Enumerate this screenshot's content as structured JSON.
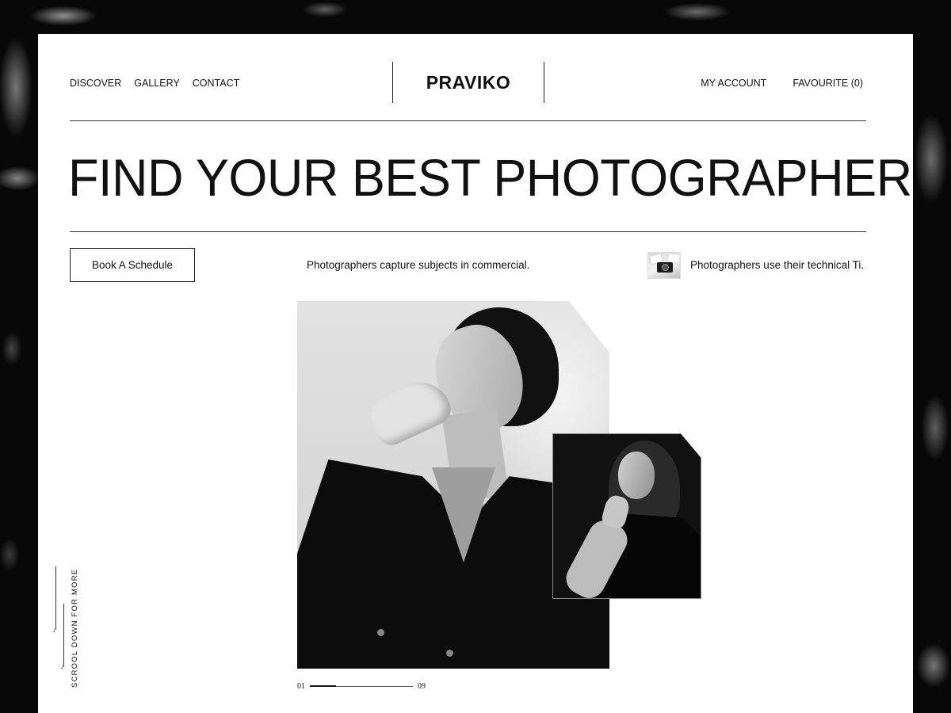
{
  "nav": {
    "left": [
      "DISCOVER",
      "GALLERY",
      "CONTACT"
    ],
    "brand": "PRAVIKO",
    "right": [
      "MY ACCOUNT",
      "FAVOURITE (0)"
    ]
  },
  "hero": {
    "title": "FIND YOUR BEST PHOTOGRAPHER",
    "cta_label": "Book A Schedule",
    "description_1": "Photographers capture subjects in commercial.",
    "description_2": "Photographers use their technical Ti."
  },
  "gallery": {
    "current_index": "01",
    "total": "09",
    "progress": 0.25
  },
  "scroll_hint": "SCROOL DOWN FOR MORE",
  "icons": {
    "thumbnail": "camera-thumbnail-icon",
    "scroll": "arrow-down-icon"
  },
  "colors": {
    "backdrop": "#080808",
    "card": "#ffffff",
    "text": "#111111"
  }
}
